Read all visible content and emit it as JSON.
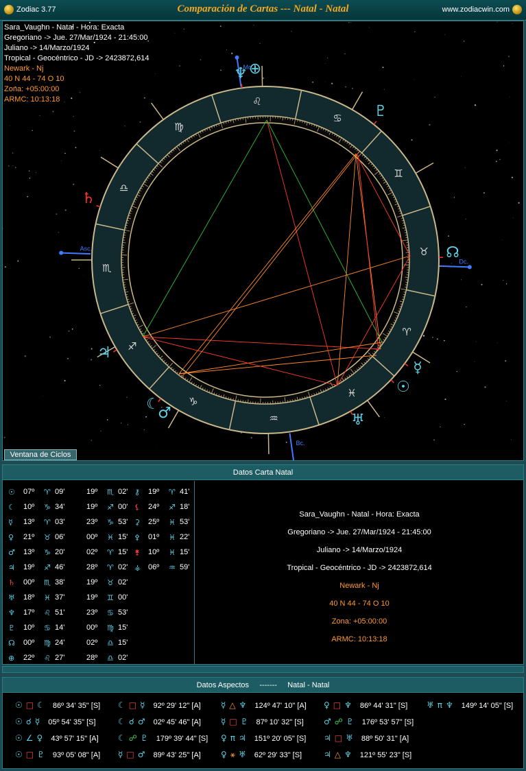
{
  "window": {
    "app": "Zodiac 3.77",
    "title": "Comparación de Cartas --- Natal - Natal",
    "site": "www.zodiacwin.com"
  },
  "chart_info": [
    {
      "text": "Sara_Vaughn - Natal - Hora: Exacta",
      "color": "white"
    },
    {
      "text": "Gregoriano -> Jue. 27/Mar/1924 - 21:45:00",
      "color": "white"
    },
    {
      "text": "Juliano -> 14/Marzo/1924",
      "color": "white"
    },
    {
      "text": "Tropical - Geocéntrico - JD -> 2423872,614",
      "color": "white"
    },
    {
      "text": "Newark - Nj",
      "color": "orange"
    },
    {
      "text": "40 N 44 - 74 O 10",
      "color": "orange"
    },
    {
      "text": "Zona: +05:00:00",
      "color": "orange"
    },
    {
      "text": "ARMC: 10:13:18",
      "color": "orange"
    }
  ],
  "wheel": {
    "axis_labels": {
      "asc": "Asc.",
      "mc": "Mc.",
      "dsc": "Dc.",
      "ic": "Bc."
    },
    "signs": [
      "♈",
      "♉",
      "♊",
      "♋",
      "♌",
      "♍",
      "♎",
      "♏",
      "♐",
      "♑",
      "♒",
      "♓"
    ],
    "planet_glyphs": [
      {
        "name": "sun-icon",
        "glyph": "☉",
        "color": "#5bd0e6"
      },
      {
        "name": "moon-icon",
        "glyph": "☾",
        "color": "#5bd0e6"
      },
      {
        "name": "mercury-icon",
        "glyph": "☿",
        "color": "#5bd0e6"
      },
      {
        "name": "venus-icon",
        "glyph": "♀",
        "color": "#5bd0e6"
      },
      {
        "name": "mars-icon",
        "glyph": "♂",
        "color": "#5bd0e6"
      },
      {
        "name": "jupiter-icon",
        "glyph": "♃",
        "color": "#5bd0e6"
      },
      {
        "name": "saturn-icon",
        "glyph": "♄",
        "color": "#ff3030"
      },
      {
        "name": "uranus-icon",
        "glyph": "♅",
        "color": "#5bd0e6"
      },
      {
        "name": "neptune-icon",
        "glyph": "♆",
        "color": "#5bd0e6"
      },
      {
        "name": "pluto-icon",
        "glyph": "♇",
        "color": "#5bd0e6"
      },
      {
        "name": "node-icon",
        "glyph": "☊",
        "color": "#5bd0e6"
      },
      {
        "name": "fortune-icon",
        "glyph": "⊕",
        "color": "#5bd0e6"
      }
    ]
  },
  "cycles_button": "Ventana de Ciclos",
  "natal_panel": {
    "title": "Datos Carta Natal",
    "rows": [
      {
        "g1": "☉",
        "p1": "07º",
        "s1": "♈",
        "m1": "09'",
        "d2": "19º",
        "s2": "♏",
        "m2": "02'",
        "g3": "⚷",
        "d3": "19º",
        "s3": "♈",
        "m3": "41'"
      },
      {
        "g1": "☾",
        "p1": "10º",
        "s1": "♑",
        "m1": "34'",
        "d2": "19º",
        "s2": "♐",
        "m2": "00'",
        "g3": "⚸",
        "d3": "24º",
        "s3": "♐",
        "m3": "18'"
      },
      {
        "g1": "☿",
        "p1": "13º",
        "s1": "♈",
        "m1": "03'",
        "d2": "23º",
        "s2": "♑",
        "m2": "53'",
        "g3": "⚳",
        "d3": "25º",
        "s3": "♓",
        "m3": "53'"
      },
      {
        "g1": "♀",
        "p1": "21º",
        "s1": "♉",
        "m1": "06'",
        "d2": "00º",
        "s2": "♓",
        "m2": "15'",
        "g3": "⚴",
        "d3": "01º",
        "s3": "♓",
        "m3": "22'"
      },
      {
        "g1": "♂",
        "p1": "13º",
        "s1": "♑",
        "m1": "20'",
        "d2": "02º",
        "s2": "♈",
        "m2": "15'",
        "g3": "⚵",
        "d3": "10º",
        "s3": "♓",
        "m3": "15'"
      },
      {
        "g1": "♃",
        "p1": "19º",
        "s1": "♐",
        "m1": "46'",
        "d2": "28º",
        "s2": "♈",
        "m2": "02'",
        "g3": "⚶",
        "d3": "06º",
        "s3": "♒",
        "m3": "59'"
      },
      {
        "g1": "♄",
        "p1": "00º",
        "s1": "♏",
        "m1": "38'",
        "d2": "19º",
        "s2": "♉",
        "m2": "02'",
        "g3": "",
        "d3": "",
        "s3": "",
        "m3": ""
      },
      {
        "g1": "♅",
        "p1": "18º",
        "s1": "♓",
        "m1": "37'",
        "d2": "19º",
        "s2": "♊",
        "m2": "00'",
        "g3": "",
        "d3": "",
        "s3": "",
        "m3": ""
      },
      {
        "g1": "♆",
        "p1": "17º",
        "s1": "♌",
        "m1": "51'",
        "d2": "23º",
        "s2": "♋",
        "m2": "53'",
        "g3": "",
        "d3": "",
        "s3": "",
        "m3": ""
      },
      {
        "g1": "♇",
        "p1": "10º",
        "s1": "♋",
        "m1": "14'",
        "d2": "00º",
        "s2": "♍",
        "m2": "15'",
        "g3": "",
        "d3": "",
        "s3": "",
        "m3": ""
      },
      {
        "g1": "☊",
        "p1": "00º",
        "s1": "♍",
        "m1": "24'",
        "d2": "02º",
        "s2": "♎",
        "m2": "15'",
        "g3": "",
        "d3": "",
        "s3": "",
        "m3": ""
      },
      {
        "g1": "⊕",
        "p1": "22º",
        "s1": "♌",
        "m1": "27'",
        "d2": "28º",
        "s2": "♎",
        "m2": "02'",
        "g3": "",
        "d3": "",
        "s3": "",
        "m3": ""
      }
    ],
    "info": [
      {
        "text": "Sara_Vaughn - Natal - Hora: Exacta",
        "color": "white"
      },
      {
        "text": "Gregoriano -> Jue. 27/Mar/1924 - 21:45:00",
        "color": "white"
      },
      {
        "text": "Juliano -> 14/Marzo/1924",
        "color": "white"
      },
      {
        "text": "Tropical - Geocéntrico - JD -> 2423872,614",
        "color": "white"
      },
      {
        "text": "Newark - Nj",
        "color": "orange"
      },
      {
        "text": "40 N 44 - 74 O 10",
        "color": "orange"
      },
      {
        "text": "Zona: +05:00:00",
        "color": "orange"
      },
      {
        "text": "ARMC: 10:13:18",
        "color": "orange"
      }
    ]
  },
  "aspects_panel": {
    "title": "Datos Aspectos     -------     Natal - Natal",
    "rows": [
      [
        {
          "a": "☉",
          "asp": "□",
          "b": "☾",
          "val": "86º 34' 35\" [S]",
          "c": "red"
        },
        {
          "a": "☾",
          "asp": "□",
          "b": "☿",
          "val": "92º 29' 12\" [A]",
          "c": "red"
        },
        {
          "a": "☿",
          "asp": "△",
          "b": "♆",
          "val": "124º 47' 10\" [A]",
          "c": "orange"
        },
        {
          "a": "♀",
          "asp": "□",
          "b": "♆",
          "val": "86º 44' 31\" [S]",
          "c": "red"
        },
        {
          "a": "♅",
          "asp": "π",
          "b": "♆",
          "val": "149º 14' 05\" [S]",
          "c": "cyan"
        }
      ],
      [
        {
          "a": "☉",
          "asp": "☌",
          "b": "☿",
          "val": "05º 54' 35\" [S]",
          "c": "cyan"
        },
        {
          "a": "☾",
          "asp": "☌",
          "b": "♂",
          "val": "02º 45' 46\" [A]",
          "c": "cyan"
        },
        {
          "a": "☿",
          "asp": "□",
          "b": "♇",
          "val": "87º 10' 32\" [S]",
          "c": "red"
        },
        {
          "a": "♂",
          "asp": "☍",
          "b": "♇",
          "val": "176º 53' 57\" [S]",
          "c": "green"
        }
      ],
      [
        {
          "a": "☉",
          "asp": "∠",
          "b": "♀",
          "val": "43º 57' 15\" [A]",
          "c": "cyan"
        },
        {
          "a": "☾",
          "asp": "☍",
          "b": "♇",
          "val": "179º 39' 44\" [S]",
          "c": "green"
        },
        {
          "a": "♀",
          "asp": "π",
          "b": "♃",
          "val": "151º 20' 05\" [S]",
          "c": "cyan"
        },
        {
          "a": "♃",
          "asp": "□",
          "b": "♅",
          "val": "88º 50' 31\" [A]",
          "c": "red"
        }
      ],
      [
        {
          "a": "☉",
          "asp": "□",
          "b": "♇",
          "val": "93º 05' 08\" [A]",
          "c": "red"
        },
        {
          "a": "☿",
          "asp": "□",
          "b": "♂",
          "val": "89º 43' 25\" [A]",
          "c": "red"
        },
        {
          "a": "♀",
          "asp": "⚹",
          "b": "♅",
          "val": "62º 29' 33\" [S]",
          "c": "orange"
        },
        {
          "a": "♃",
          "asp": "△",
          "b": "♆",
          "val": "121º 55' 23\" [S]",
          "c": "orange"
        }
      ]
    ]
  }
}
